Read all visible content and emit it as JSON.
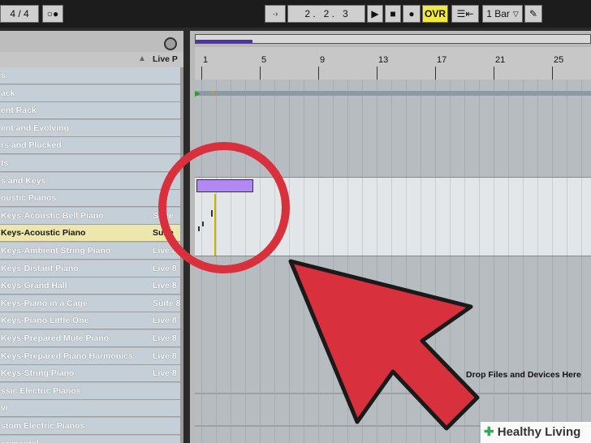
{
  "transport": {
    "signature": "4 / 4",
    "position": "2 .   2 .   3",
    "ovr_label": "OVR",
    "quantize": "1 Bar"
  },
  "browser": {
    "column_header": "Live P",
    "rows": [
      {
        "name": "s",
        "col2": ""
      },
      {
        "name": "ack",
        "col2": ""
      },
      {
        "name": "ent Rack",
        "col2": ""
      },
      {
        "name": "ent and Evolving",
        "col2": ""
      },
      {
        "name": "rs and Plucked",
        "col2": ""
      },
      {
        "name": "ts",
        "col2": ""
      },
      {
        "name": "s and Keys",
        "col2": ""
      },
      {
        "name": "oustic Pianos",
        "col2": ""
      },
      {
        "name": "Keys-Acoustic Bell Piano",
        "col2": "Suite"
      },
      {
        "name": "Keys-Acoustic Piano",
        "col2": "Suite"
      },
      {
        "name": "Keys-Ambient String Piano",
        "col2": "Live 8"
      },
      {
        "name": "Keys-Distant Piano",
        "col2": "Live 8"
      },
      {
        "name": "Keys-Grand Hall",
        "col2": "Live 8"
      },
      {
        "name": "Keys-Piano in a Cage",
        "col2": "Suite 8"
      },
      {
        "name": "Keys-Piano Little One",
        "col2": "Live 8"
      },
      {
        "name": "Keys-Prepared Mute Piano",
        "col2": "Live 8"
      },
      {
        "name": "Keys-Prepared Piano Harmonics",
        "col2": "Live 8"
      },
      {
        "name": "Keys-String Piano",
        "col2": "Live 8"
      },
      {
        "name": "ssic Electric Pianos",
        "col2": ""
      },
      {
        "name": "vi",
        "col2": ""
      },
      {
        "name": "stom Electric Pianos",
        "col2": ""
      },
      {
        "name": "erimental",
        "col2": ""
      }
    ]
  },
  "ruler": {
    "bars": [
      "1",
      "5",
      "9",
      "13",
      "17",
      "21",
      "25"
    ]
  },
  "arrangement": {
    "drop_hint": "Drop Files and Devices Here"
  },
  "watermark": "Healthy Living",
  "colors": {
    "highlight_red": "#d8303c",
    "clip_purple": "#b288f5",
    "selected_row": "#ede6ad",
    "ovr_yellow": "#f2e93a"
  }
}
